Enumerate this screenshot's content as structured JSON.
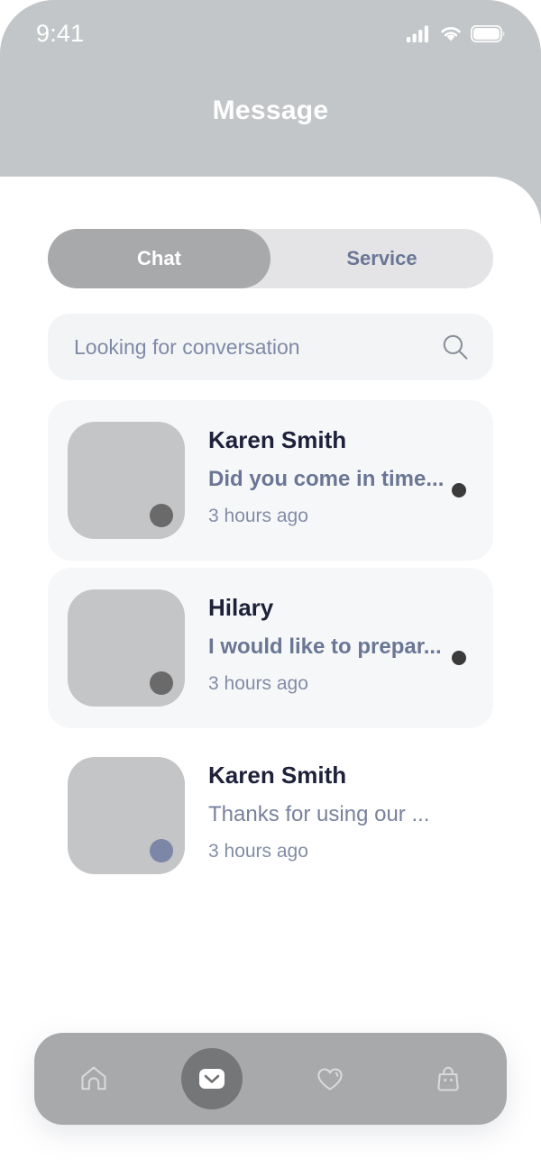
{
  "statusbar": {
    "time": "9:41",
    "icons": [
      "cellular-signal-icon",
      "wifi-icon",
      "battery-icon"
    ]
  },
  "header": {
    "title": "Message"
  },
  "tabs": {
    "items": [
      {
        "label": "Chat",
        "active": true
      },
      {
        "label": "Service",
        "active": false
      }
    ]
  },
  "search": {
    "value": "",
    "placeholder": "Looking for conversation",
    "icon": "search-icon"
  },
  "conversations": [
    {
      "name": "Karen Smith",
      "preview": "Did you come in time...",
      "time": "3 hours ago",
      "unread": true,
      "status_dot": "#6a6a6a"
    },
    {
      "name": "Hilary",
      "preview": "I would like to prepar...",
      "time": "3 hours ago",
      "unread": true,
      "status_dot": "#6a6a6a"
    },
    {
      "name": "Karen Smith",
      "preview": "Thanks for using our ...",
      "time": "3 hours ago",
      "unread": false,
      "status_dot": "#7c87a8"
    }
  ],
  "bottom_nav": {
    "items": [
      {
        "icon": "home-icon",
        "active": false
      },
      {
        "icon": "envelope-icon",
        "active": true
      },
      {
        "icon": "heart-icon",
        "active": false
      },
      {
        "icon": "shopping-bag-icon",
        "active": false
      }
    ]
  },
  "colors": {
    "header_gray": "#c3c6c8",
    "tab_track": "#e4e4e6",
    "tab_active": "#a8a9ab",
    "accent_text": "#6a7694",
    "name_text": "#1e2139",
    "card_bg": "#f6f7f9",
    "search_bg": "#f3f4f6",
    "nav_bg": "#a8a9ab",
    "nav_active_circle": "#757678",
    "unread_dot": "#3b3b3b"
  }
}
